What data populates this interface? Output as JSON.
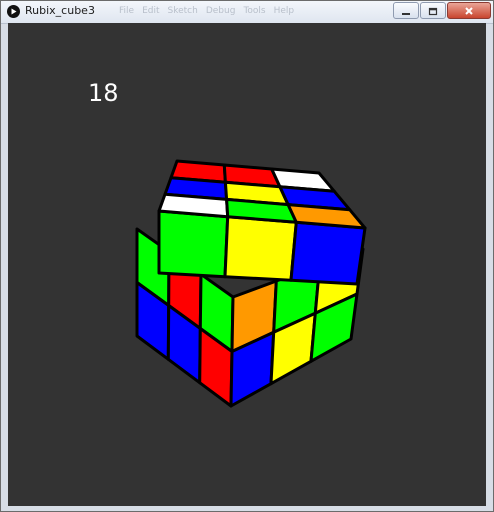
{
  "window": {
    "title": "Rubix_cube3",
    "menu_items": [
      "File",
      "Edit",
      "Sketch",
      "Debug",
      "Tools",
      "Help"
    ]
  },
  "canvas": {
    "background": "#333333",
    "counter": "18"
  },
  "cube": {
    "colors": {
      "red": "#ff0000",
      "green": "#00ff00",
      "blue": "#0000ff",
      "yellow": "#ffff00",
      "orange": "#ff9900",
      "white": "#ffffff",
      "edge": "#000000"
    },
    "top_face": [
      [
        "red",
        "red",
        "white"
      ],
      [
        "blue",
        "yellow",
        "blue"
      ],
      [
        "white",
        "green",
        "orange"
      ]
    ],
    "top_layer_front_face": [
      "green",
      "yellow",
      "blue"
    ],
    "lower_left_face": [
      [
        "green",
        "red",
        "green"
      ],
      [
        "blue",
        "blue",
        "red"
      ]
    ],
    "lower_right_face": [
      [
        "orange",
        "green",
        "yellow"
      ],
      [
        "blue",
        "yellow",
        "green"
      ]
    ]
  }
}
